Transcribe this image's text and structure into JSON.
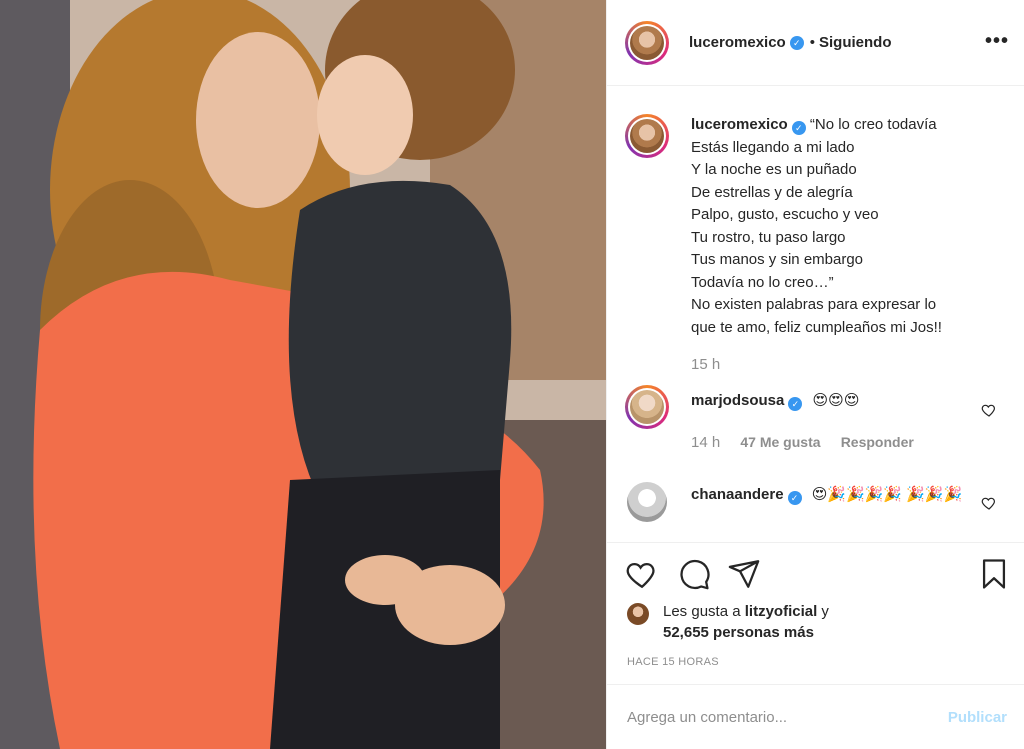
{
  "header": {
    "username": "luceromexico",
    "verified_mark": "✓",
    "separator": "•",
    "follow_status": "Siguiendo",
    "more_icon": "•••"
  },
  "caption": {
    "username": "luceromexico",
    "lines": [
      "“No lo creo todavía",
      "Estás llegando a mi lado",
      "Y la noche es un puñado",
      "De estrellas y de alegría",
      "Palpo, gusto, escucho y veo",
      "Tu rostro, tu paso largo",
      "Tus manos y sin embargo",
      "Todavía no lo creo…”",
      "No existen palabras para expresar lo",
      "que te amo, feliz cumpleaños mi Jos!!"
    ],
    "time": "15 h"
  },
  "comments": [
    {
      "username": "marjodsousa",
      "text": "😍😍😍",
      "time": "14 h",
      "likes": "47 Me gusta",
      "reply": "Responder"
    },
    {
      "username": "chanaandere",
      "text": "😍🎉🎉🎉🎉",
      "text2": "🎉🎉🎉"
    }
  ],
  "actions": {
    "like_icon": "heart-icon",
    "comment_icon": "comment-icon",
    "share_icon": "share-icon",
    "save_icon": "bookmark-icon"
  },
  "likes": {
    "prefix": "Les gusta a ",
    "user": "litzyoficial",
    "suffix": " y",
    "count": "52,655 personas más"
  },
  "timestamp": "HACE 15 HORAS",
  "add_comment": {
    "placeholder": "Agrega un comentario...",
    "publish": "Publicar"
  },
  "colors": {
    "verified": "#3897f0",
    "publish_disabled": "#b2dffc",
    "muted": "#8e8e8e",
    "text": "#262626"
  }
}
